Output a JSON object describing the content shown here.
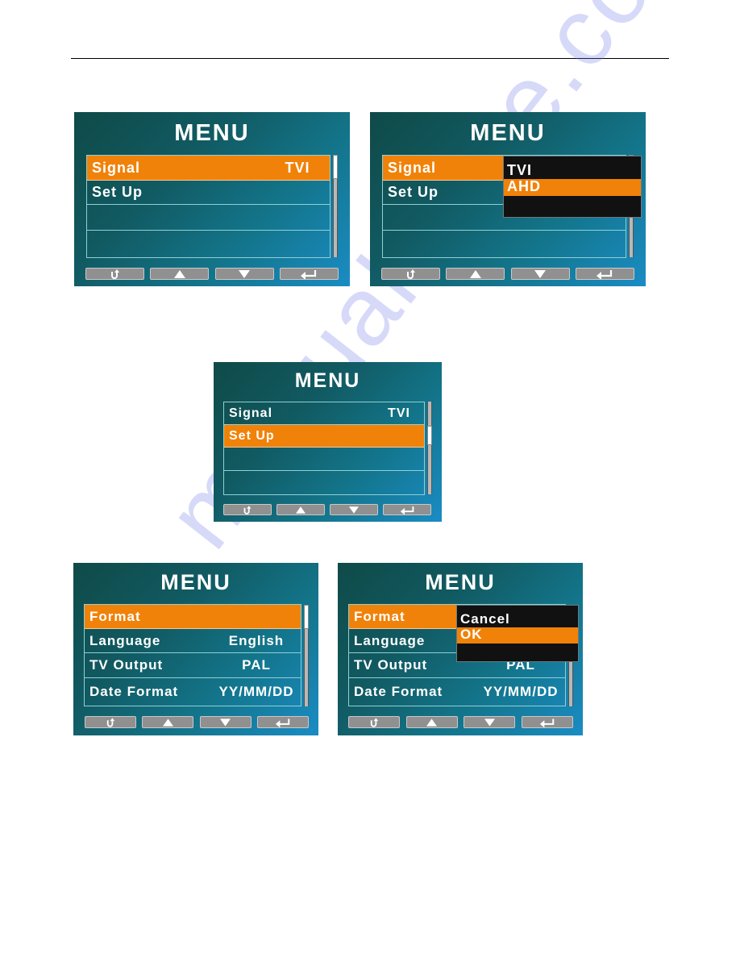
{
  "watermark": "manualshive.com",
  "panels": [
    {
      "id": "signal-menu",
      "title": "MENU",
      "rows": [
        {
          "label": "Signal",
          "value": "TVI",
          "selected": true
        },
        {
          "label": "Set Up",
          "value": "",
          "selected": false
        },
        {
          "label": "",
          "value": "",
          "selected": false
        },
        {
          "label": "",
          "value": "",
          "selected": false
        }
      ],
      "buttons": [
        "back",
        "up",
        "down",
        "enter"
      ]
    },
    {
      "id": "signal-popup-menu",
      "title": "MENU",
      "rows": [
        {
          "label": "Signal",
          "value": "",
          "selected": true
        },
        {
          "label": "Set Up",
          "value": "",
          "selected": false
        },
        {
          "label": "",
          "value": "",
          "selected": false
        },
        {
          "label": "",
          "value": "",
          "selected": false
        }
      ],
      "popup": {
        "options": [
          {
            "label": "TVI",
            "selected": false
          },
          {
            "label": "AHD",
            "selected": true
          },
          {
            "label": "",
            "selected": false
          }
        ]
      },
      "buttons": [
        "back",
        "up",
        "down",
        "enter"
      ]
    },
    {
      "id": "setup-selected-menu",
      "title": "MENU",
      "rows": [
        {
          "label": "Signal",
          "value": "TVI",
          "selected": false
        },
        {
          "label": "Set Up",
          "value": "",
          "selected": true
        },
        {
          "label": "",
          "value": "",
          "selected": false
        },
        {
          "label": "",
          "value": "",
          "selected": false
        }
      ],
      "buttons": [
        "back",
        "up",
        "down",
        "enter"
      ]
    },
    {
      "id": "setup-menu",
      "title": "MENU",
      "rows": [
        {
          "label": "Format",
          "value": "",
          "selected": true
        },
        {
          "label": "Language",
          "value": "English",
          "selected": false
        },
        {
          "label": "TV Output",
          "value": "PAL",
          "selected": false
        },
        {
          "label": "Date Format",
          "value": "YY/MM/DD",
          "selected": false
        }
      ],
      "buttons": [
        "back",
        "up",
        "down",
        "enter"
      ]
    },
    {
      "id": "format-popup-menu",
      "title": "MENU",
      "rows": [
        {
          "label": "Format",
          "value": "",
          "selected": true
        },
        {
          "label": "Language",
          "value": "",
          "selected": false
        },
        {
          "label": "TV Output",
          "value": "PAL",
          "selected": false
        },
        {
          "label": "Date Format",
          "value": "YY/MM/DD",
          "selected": false
        }
      ],
      "popup": {
        "options": [
          {
            "label": "Cancel",
            "selected": false
          },
          {
            "label": "OK",
            "selected": true
          },
          {
            "label": "",
            "selected": false
          }
        ]
      },
      "buttons": [
        "back",
        "up",
        "down",
        "enter"
      ]
    }
  ],
  "icons": {
    "back": "back-icon",
    "up": "arrow-up-icon",
    "down": "arrow-down-icon",
    "enter": "enter-icon"
  }
}
